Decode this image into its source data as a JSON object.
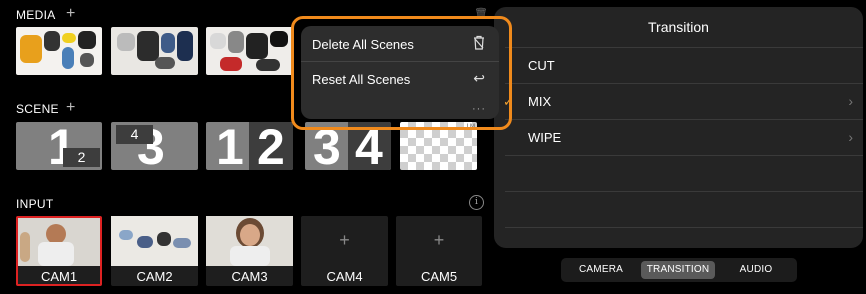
{
  "media": {
    "label": "MEDIA",
    "add_icon": "plus-icon",
    "delete_icon": "trash-icon"
  },
  "scene": {
    "label": "SCENE",
    "add_icon": "plus-icon",
    "items": [
      {
        "big": "1",
        "small": "2"
      },
      {
        "big": "3",
        "small": "4"
      },
      {
        "left": "1",
        "right": "2"
      },
      {
        "left": "3",
        "right": "4"
      },
      {
        "corner": "LM"
      }
    ]
  },
  "input": {
    "label": "INPUT",
    "info_icon": "info-icon",
    "items": [
      {
        "name": "CAM1",
        "selected": true,
        "empty": false
      },
      {
        "name": "CAM2",
        "selected": false,
        "empty": false
      },
      {
        "name": "CAM3",
        "selected": false,
        "empty": false
      },
      {
        "name": "CAM4",
        "selected": false,
        "empty": true
      },
      {
        "name": "CAM5",
        "selected": false,
        "empty": true
      }
    ],
    "empty_symbol": "+"
  },
  "popover": {
    "items": [
      {
        "label": "Delete All Scenes",
        "icon": "trash-icon",
        "glyph": "🗑"
      },
      {
        "label": "Reset All Scenes",
        "icon": "undo-icon",
        "glyph": "↩"
      }
    ],
    "more_symbol": "···",
    "highlight_color": "#f08a1c"
  },
  "transition_panel": {
    "title": "Transition",
    "options": [
      {
        "label": "CUT",
        "checked": false,
        "chevron": false
      },
      {
        "label": "MIX",
        "checked": true,
        "chevron": true
      },
      {
        "label": "WIPE",
        "checked": false,
        "chevron": true
      }
    ],
    "check_symbol": "✓",
    "chevron_symbol": "›",
    "check_color": "#f0a030"
  },
  "tabs": {
    "items": [
      "CAMERA",
      "TRANSITION",
      "AUDIO"
    ],
    "active": "TRANSITION"
  }
}
